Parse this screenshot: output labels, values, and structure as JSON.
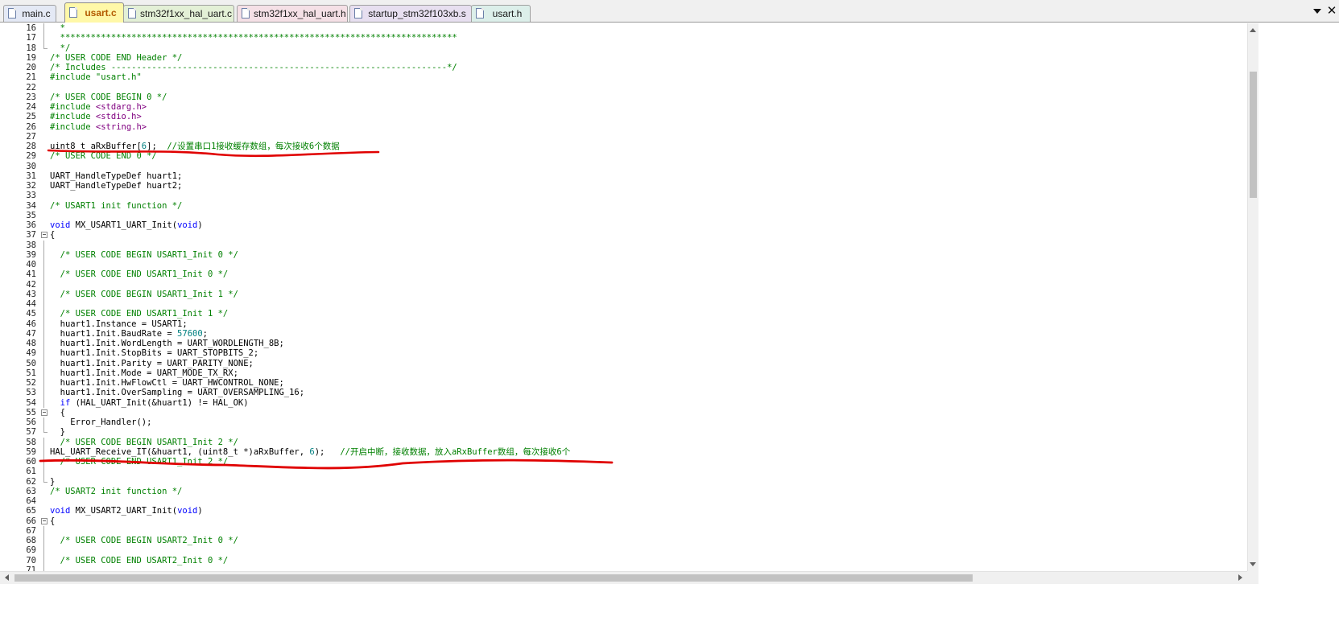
{
  "tabs": [
    {
      "label": "main.c",
      "active": false,
      "color": "#e4e9f5"
    },
    {
      "label": "usart.c",
      "active": true,
      "color": "#fff8a8"
    },
    {
      "label": "stm32f1xx_hal_uart.c",
      "active": false,
      "color": "#e3f0d6"
    },
    {
      "label": "stm32f1xx_hal_uart.h",
      "active": false,
      "color": "#f5e0e6"
    },
    {
      "label": "startup_stm32f103xb.s",
      "active": false,
      "color": "#e7dff0"
    },
    {
      "label": "usart.h",
      "active": false,
      "color": "#dcefea"
    }
  ],
  "editor": {
    "lines": [
      {
        "n": "16",
        "fold": "line",
        "tokens": [
          [
            "  *",
            "comment"
          ]
        ]
      },
      {
        "n": "17",
        "fold": "line",
        "tokens": [
          [
            "  ******************************************************************************",
            "comment"
          ]
        ]
      },
      {
        "n": "18",
        "fold": "end",
        "tokens": [
          [
            "  */",
            "comment"
          ]
        ]
      },
      {
        "n": "19",
        "fold": "",
        "tokens": [
          [
            "/* USER CODE END Header */",
            "comment"
          ]
        ]
      },
      {
        "n": "20",
        "fold": "",
        "tokens": [
          [
            "/* Includes ------------------------------------------------------------------*/",
            "comment"
          ]
        ]
      },
      {
        "n": "21",
        "fold": "",
        "tokens": [
          [
            "#include \"usart.h\"",
            "pre"
          ]
        ]
      },
      {
        "n": "22",
        "fold": "",
        "tokens": []
      },
      {
        "n": "23",
        "fold": "",
        "tokens": [
          [
            "/* USER CODE BEGIN 0 */",
            "comment"
          ]
        ]
      },
      {
        "n": "24",
        "fold": "",
        "tokens": [
          [
            "#include ",
            "pre"
          ],
          [
            "<stdarg.h>",
            "inc"
          ]
        ]
      },
      {
        "n": "25",
        "fold": "",
        "tokens": [
          [
            "#include ",
            "pre"
          ],
          [
            "<stdio.h>",
            "inc"
          ]
        ]
      },
      {
        "n": "26",
        "fold": "",
        "tokens": [
          [
            "#include ",
            "pre"
          ],
          [
            "<string.h>",
            "inc"
          ]
        ]
      },
      {
        "n": "27",
        "fold": "",
        "tokens": []
      },
      {
        "n": "28",
        "fold": "",
        "tokens": [
          [
            "uint8_t aRxBuffer[",
            "plain"
          ],
          [
            "6",
            "num"
          ],
          [
            "];  ",
            "plain"
          ],
          [
            "//设置串口1接收缓存数组，每次接收6个数据",
            "comment"
          ]
        ]
      },
      {
        "n": "29",
        "fold": "",
        "tokens": [
          [
            "/* USER CODE END 0 */",
            "comment"
          ]
        ]
      },
      {
        "n": "30",
        "fold": "",
        "tokens": []
      },
      {
        "n": "31",
        "fold": "",
        "tokens": [
          [
            "UART_HandleTypeDef huart1;",
            "plain"
          ]
        ]
      },
      {
        "n": "32",
        "fold": "",
        "tokens": [
          [
            "UART_HandleTypeDef huart2;",
            "plain"
          ]
        ]
      },
      {
        "n": "33",
        "fold": "",
        "tokens": []
      },
      {
        "n": "34",
        "fold": "",
        "tokens": [
          [
            "/* USART1 init function */",
            "comment"
          ]
        ]
      },
      {
        "n": "35",
        "fold": "",
        "tokens": []
      },
      {
        "n": "36",
        "fold": "",
        "tokens": [
          [
            "void",
            "kw"
          ],
          [
            " MX_USART1_UART_Init(",
            "plain"
          ],
          [
            "void",
            "kw"
          ],
          [
            ")",
            "plain"
          ]
        ]
      },
      {
        "n": "37",
        "fold": "box",
        "tokens": [
          [
            "{",
            "plain"
          ]
        ]
      },
      {
        "n": "38",
        "fold": "line",
        "tokens": []
      },
      {
        "n": "39",
        "fold": "line",
        "tokens": [
          [
            "  /* USER CODE BEGIN USART1_Init 0 */",
            "comment"
          ]
        ]
      },
      {
        "n": "40",
        "fold": "line",
        "tokens": []
      },
      {
        "n": "41",
        "fold": "line",
        "tokens": [
          [
            "  /* USER CODE END USART1_Init 0 */",
            "comment"
          ]
        ]
      },
      {
        "n": "42",
        "fold": "line",
        "tokens": []
      },
      {
        "n": "43",
        "fold": "line",
        "tokens": [
          [
            "  /* USER CODE BEGIN USART1_Init 1 */",
            "comment"
          ]
        ]
      },
      {
        "n": "44",
        "fold": "line",
        "tokens": []
      },
      {
        "n": "45",
        "fold": "line",
        "tokens": [
          [
            "  /* USER CODE END USART1_Init 1 */",
            "comment"
          ]
        ]
      },
      {
        "n": "46",
        "fold": "line",
        "tokens": [
          [
            "  huart1.Instance = USART1;",
            "plain"
          ]
        ]
      },
      {
        "n": "47",
        "fold": "line",
        "tokens": [
          [
            "  huart1.Init.BaudRate = ",
            "plain"
          ],
          [
            "57600",
            "num"
          ],
          [
            ";",
            "plain"
          ]
        ]
      },
      {
        "n": "48",
        "fold": "line",
        "tokens": [
          [
            "  huart1.Init.WordLength = UART_WORDLENGTH_8B;",
            "plain"
          ]
        ]
      },
      {
        "n": "49",
        "fold": "line",
        "tokens": [
          [
            "  huart1.Init.StopBits = UART_STOPBITS_2;",
            "plain"
          ]
        ]
      },
      {
        "n": "50",
        "fold": "line",
        "tokens": [
          [
            "  huart1.Init.Parity = UART_PARITY_NONE;",
            "plain"
          ]
        ]
      },
      {
        "n": "51",
        "fold": "line",
        "tokens": [
          [
            "  huart1.Init.Mode = UART_MODE_TX_RX;",
            "plain"
          ]
        ]
      },
      {
        "n": "52",
        "fold": "line",
        "tokens": [
          [
            "  huart1.Init.HwFlowCtl = UART_HWCONTROL_NONE;",
            "plain"
          ]
        ]
      },
      {
        "n": "53",
        "fold": "line",
        "tokens": [
          [
            "  huart1.Init.OverSampling = UART_OVERSAMPLING_16;",
            "plain"
          ]
        ]
      },
      {
        "n": "54",
        "fold": "line",
        "tokens": [
          [
            "  ",
            "plain"
          ],
          [
            "if",
            "kw"
          ],
          [
            " (HAL_UART_Init(&huart1) != HAL_OK)",
            "plain"
          ]
        ]
      },
      {
        "n": "55",
        "fold": "box",
        "tokens": [
          [
            "  {",
            "plain"
          ]
        ]
      },
      {
        "n": "56",
        "fold": "line",
        "tokens": [
          [
            "    Error_Handler();",
            "plain"
          ]
        ]
      },
      {
        "n": "57",
        "fold": "end",
        "tokens": [
          [
            "  }",
            "plain"
          ]
        ]
      },
      {
        "n": "58",
        "fold": "line",
        "tokens": [
          [
            "  /* USER CODE BEGIN USART1_Init 2 */",
            "comment"
          ]
        ]
      },
      {
        "n": "59",
        "fold": "line",
        "tokens": [
          [
            "HAL_UART_Receive_IT(&huart1, (uint8_t *)aRxBuffer, ",
            "plain"
          ],
          [
            "6",
            "num"
          ],
          [
            ");   ",
            "plain"
          ],
          [
            "//开启中断，接收数据，放入aRxBuffer数组，每次接收6个",
            "comment"
          ]
        ]
      },
      {
        "n": "60",
        "fold": "line",
        "tokens": [
          [
            "  /* USER CODE END USART1_Init 2 */",
            "comment"
          ]
        ]
      },
      {
        "n": "61",
        "fold": "line",
        "tokens": []
      },
      {
        "n": "62",
        "fold": "end",
        "tokens": [
          [
            "}",
            "plain"
          ]
        ]
      },
      {
        "n": "63",
        "fold": "",
        "tokens": [
          [
            "/* USART2 init function */",
            "comment"
          ]
        ]
      },
      {
        "n": "64",
        "fold": "",
        "tokens": []
      },
      {
        "n": "65",
        "fold": "",
        "tokens": [
          [
            "void",
            "kw"
          ],
          [
            " MX_USART2_UART_Init(",
            "plain"
          ],
          [
            "void",
            "kw"
          ],
          [
            ")",
            "plain"
          ]
        ]
      },
      {
        "n": "66",
        "fold": "box",
        "tokens": [
          [
            "{",
            "plain"
          ]
        ]
      },
      {
        "n": "67",
        "fold": "line",
        "tokens": []
      },
      {
        "n": "68",
        "fold": "line",
        "tokens": [
          [
            "  /* USER CODE BEGIN USART2_Init 0 */",
            "comment"
          ]
        ]
      },
      {
        "n": "69",
        "fold": "line",
        "tokens": []
      },
      {
        "n": "70",
        "fold": "line",
        "tokens": [
          [
            "  /* USER CODE END USART2_Init 0 */",
            "comment"
          ]
        ]
      },
      {
        "n": "71",
        "fold": "line",
        "tokens": []
      }
    ]
  },
  "annotation_color": "#e00000",
  "icons": {
    "tab_file": "file-icon",
    "tab_list": "chevron-down-icon",
    "tab_close": "close-icon"
  }
}
